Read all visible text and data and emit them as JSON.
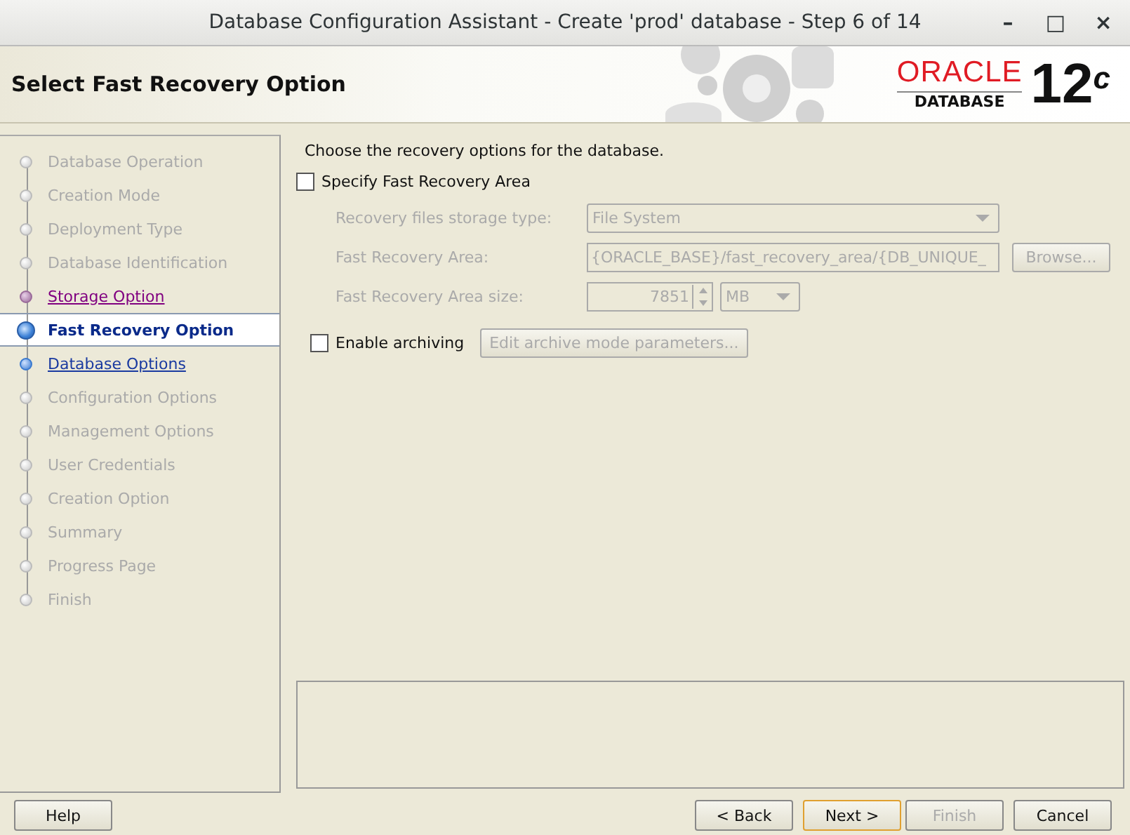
{
  "window": {
    "title": "Database Configuration Assistant - Create 'prod' database - Step 6 of 14",
    "controls": [
      "–",
      "□",
      "×"
    ]
  },
  "header": {
    "title": "Select Fast Recovery Option",
    "logo": {
      "brand": "ORACLE",
      "product": "DATABASE",
      "version": "12$^{c}$"
    }
  },
  "steps": [
    {
      "label": "Database Operation",
      "kind": "disabled",
      "selected": false
    },
    {
      "label": "Creation Mode",
      "kind": "disabled",
      "selected": false
    },
    {
      "label": "Deployment Type",
      "kind": "disabled",
      "selected": false
    },
    {
      "label": "Database Identification",
      "kind": "disabled",
      "selected": false
    },
    {
      "label": "Storage Option",
      "kind": "visited",
      "selected": false
    },
    {
      "label": "Fast Recovery Option",
      "kind": "current",
      "selected": true
    },
    {
      "label": "Database Options",
      "kind": "link",
      "selected": false
    },
    {
      "label": "Configuration Options",
      "kind": "disabled",
      "selected": false
    },
    {
      "label": "Management Options",
      "kind": "disabled",
      "selected": false
    },
    {
      "label": "User Credentials",
      "kind": "disabled",
      "selected": false
    },
    {
      "label": "Creation Option",
      "kind": "disabled",
      "selected": false
    },
    {
      "label": "Summary",
      "kind": "disabled",
      "selected": false
    },
    {
      "label": "Progress Page",
      "kind": "disabled",
      "selected": false
    },
    {
      "label": "Finish",
      "kind": "disabled",
      "selected": false
    }
  ],
  "content": {
    "intro": "Choose the recovery options for the database.",
    "specify_fra": {
      "label": "Specify Fast Recovery Area",
      "checked": false
    },
    "storage_type": {
      "label": "Recovery files storage type:",
      "value": "File System",
      "disabled": true
    },
    "fra_location": {
      "label": "Fast Recovery Area:",
      "value": "{ORACLE_BASE}/fast_recovery_area/{DB_UNIQUE_",
      "button": "Browse...",
      "disabled": true
    },
    "fra_size": {
      "label": "Fast Recovery Area size:",
      "value": "7851",
      "unit": "MB",
      "disabled": true
    },
    "archiving": {
      "label": "Enable archiving",
      "checked": false,
      "button": "Edit archive mode parameters...",
      "disabled": true
    }
  },
  "buttons": [
    {
      "label": "Help",
      "disabled": false,
      "focused": false
    },
    {
      "label": "< Back",
      "disabled": false,
      "focused": false
    },
    {
      "label": "Next >",
      "disabled": false,
      "focused": true
    },
    {
      "label": "Finish",
      "disabled": true,
      "focused": false
    },
    {
      "label": "Cancel",
      "disabled": false,
      "focused": false
    }
  ]
}
